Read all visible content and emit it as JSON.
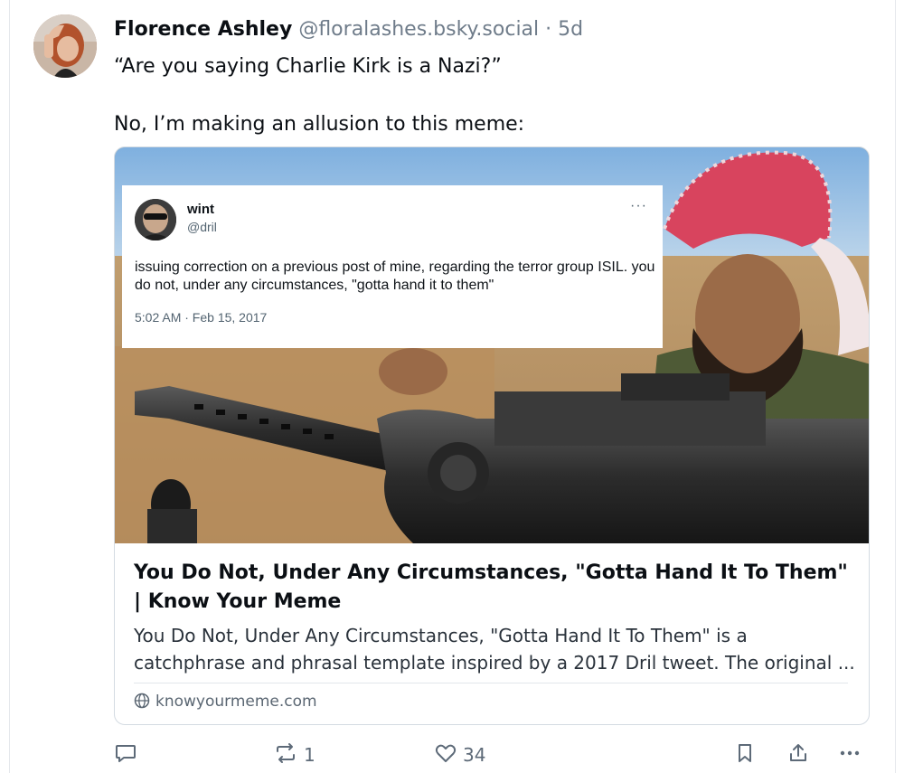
{
  "post": {
    "author": {
      "display_name": "Florence Ashley",
      "handle": "@floralashes.bsky.social",
      "separator": "·",
      "age": "5d"
    },
    "text": {
      "line1": "“Are you saying Charlie Kirk is a Nazi?”",
      "line2": "No, I’m making an allusion to this meme:"
    }
  },
  "card": {
    "embedded_tweet": {
      "name": "wint",
      "handle": "@dril",
      "more_label": "···",
      "text": "issuing correction on a previous post of mine, regarding the terror group ISIL. you do not, under any circumstances, \"gotta hand it to them\"",
      "timestamp": "5:02 AM · Feb 15, 2017"
    },
    "title": "You Do Not, Under Any Circumstances, \"Gotta Hand It To Them\" | Know Your Meme",
    "description": "You Do Not, Under Any Circumstances, \"Gotta Hand It To Them\" is a catchphrase and phrasal template inspired by a 2017 Dril tweet. The original ...",
    "domain": "knowyourmeme.com",
    "domain_icon": "globe-icon"
  },
  "actions": {
    "reply": {
      "icon": "reply-icon",
      "count": ""
    },
    "repost": {
      "icon": "repost-icon",
      "count": "1"
    },
    "like": {
      "icon": "heart-icon",
      "count": "34"
    },
    "bookmark": {
      "icon": "bookmark-icon"
    },
    "share": {
      "icon": "share-icon"
    },
    "more": {
      "icon": "more-icon"
    }
  },
  "colors": {
    "text_primary": "#0b0f14",
    "text_secondary": "#6f7c8a",
    "icon_gray": "#5d6a78",
    "border": "#d4dbe2"
  }
}
